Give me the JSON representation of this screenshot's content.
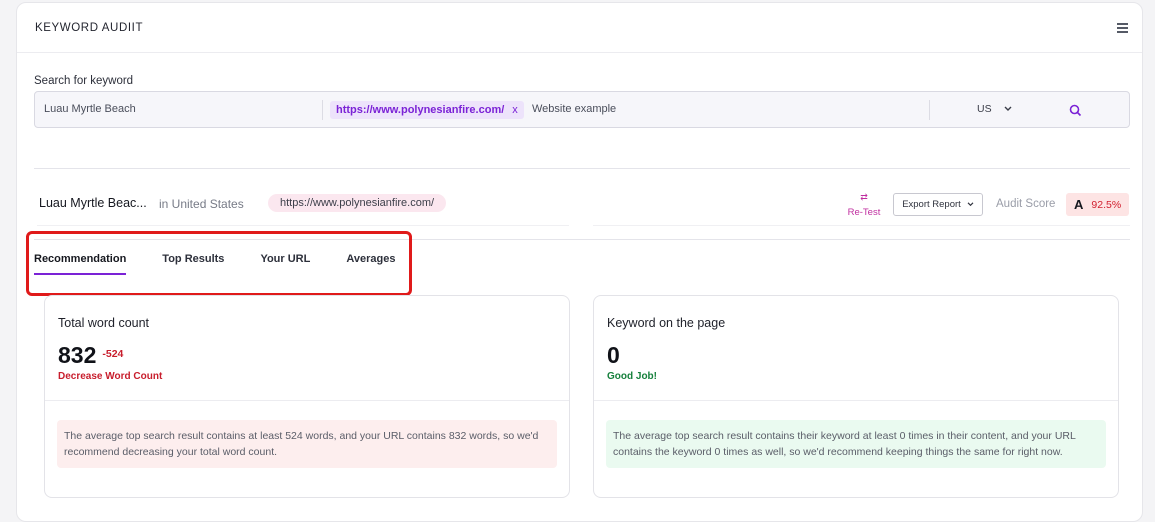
{
  "header": {
    "title": "KEYWORD AUDIIT"
  },
  "search": {
    "label": "Search for keyword",
    "keyword": "Luau Myrtle Beach",
    "url_chip": "https://www.polynesianfire.com/",
    "chip_remove": "x",
    "website_placeholder": "Website example",
    "country": "US"
  },
  "summary": {
    "keyword": "Luau Myrtle Beac...",
    "location": "in United States",
    "url": "https://www.polynesianfire.com/",
    "retest_label": "Re-Test",
    "export_label": "Export Report",
    "audit_label": "Audit Score",
    "grade": "A",
    "score": "92.5%"
  },
  "tabs": [
    {
      "label": "Recommendation"
    },
    {
      "label": "Top Results"
    },
    {
      "label": "Your URL"
    },
    {
      "label": "Averages"
    }
  ],
  "cards": [
    {
      "title": "Total word count",
      "value": "832",
      "delta": "-524",
      "status": "Decrease Word Count",
      "note": "The average top search result contains at least 524 words, and your URL contains 832 words, so we'd recommend decreasing your total word count."
    },
    {
      "title": "Keyword on the page",
      "value": "0",
      "status": "Good Job!",
      "note": "The average top search result contains their keyword at least 0 times in their content, and your URL contains the keyword 0 times as well, so we'd recommend keeping things the same for right now."
    }
  ],
  "colors": {
    "accent": "#7b22d6",
    "danger": "#c81e2d",
    "success": "#16803c",
    "annotation": "#e01a1a"
  }
}
